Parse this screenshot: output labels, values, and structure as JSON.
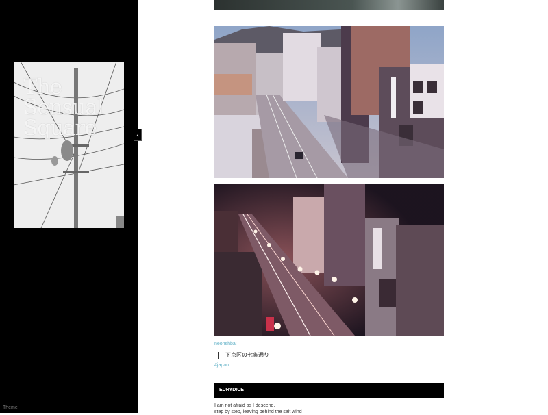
{
  "sidebar": {
    "cover_title": "The Sensual Square",
    "footer_link": "Theme",
    "toggle_glyph": "‹"
  },
  "post": {
    "source_user": "neonshba:",
    "quote": "下京区の七条通り",
    "tag": "#japan"
  },
  "next_post": {
    "title": "EURYDICE",
    "lines": [
      "I am not afraid as I descend,",
      "step by step, leaving behind the salt wind"
    ]
  },
  "colors": {
    "sidebar_bg": "#000000",
    "link": "#5fb0c6",
    "page_bg": "#ffffff"
  }
}
